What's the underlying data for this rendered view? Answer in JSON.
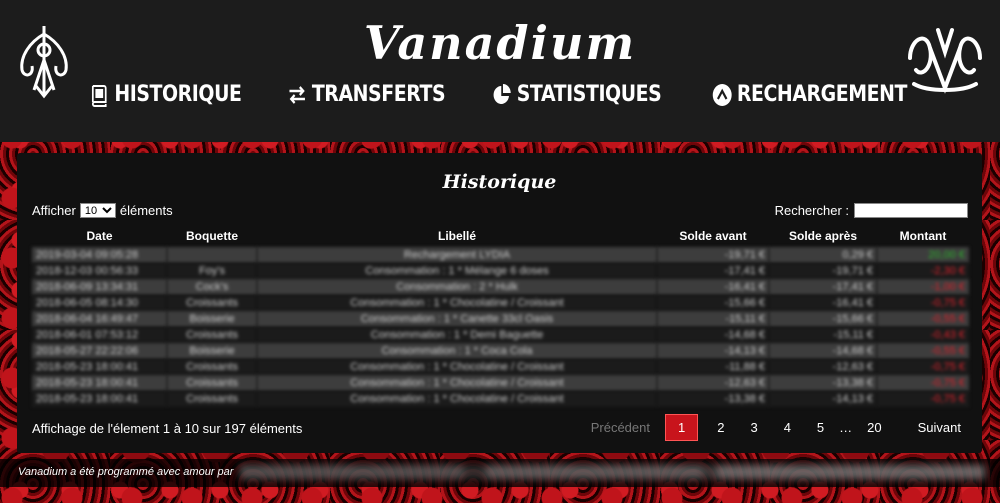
{
  "app": {
    "title": "Vanadium"
  },
  "nav": {
    "items": [
      {
        "label": "HISTORIQUE",
        "icon": "book-icon"
      },
      {
        "label": "TRANSFERTS",
        "icon": "exchange-icon"
      },
      {
        "label": "STATISTIQUES",
        "icon": "pie-chart-icon"
      },
      {
        "label": "RECHARGEMENT",
        "icon": "arrow-up-circle-icon"
      }
    ]
  },
  "panel": {
    "title": "Historique",
    "length_prefix": "Afficher",
    "length_value": "10",
    "length_suffix": "éléments",
    "search_label": "Rechercher :",
    "search_value": ""
  },
  "table": {
    "headers": [
      "Date",
      "Boquette",
      "Libellé",
      "Solde avant",
      "Solde après",
      "Montant"
    ],
    "rows": [
      {
        "date": "2019-03-04 09:05:28",
        "boquette": "",
        "libelle": "Rechargement LYDIA",
        "avant": "-19,71 €",
        "apres": "0,29 €",
        "montant": "20,00 €"
      },
      {
        "date": "2018-12-03 00:56:33",
        "boquette": "Foy's",
        "libelle": "Consommation : 1 * Mélange 6 doses",
        "avant": "-17,41 €",
        "apres": "-19,71 €",
        "montant": "-2,30 €"
      },
      {
        "date": "2018-06-09 13:34:31",
        "boquette": "Cock's",
        "libelle": "Consommation : 2 * Hulk",
        "avant": "-16,41 €",
        "apres": "-17,41 €",
        "montant": "-1,00 €"
      },
      {
        "date": "2018-06-05 08:14:30",
        "boquette": "Croissants",
        "libelle": "Consommation : 1 * Chocolatine / Croissant",
        "avant": "-15,66 €",
        "apres": "-16,41 €",
        "montant": "-0,75 €"
      },
      {
        "date": "2018-06-04 16:49:47",
        "boquette": "Boisserie",
        "libelle": "Consommation : 1 * Canette 33cl Oasis",
        "avant": "-15,11 €",
        "apres": "-15,66 €",
        "montant": "-0,55 €"
      },
      {
        "date": "2018-06-01 07:53:12",
        "boquette": "Croissants",
        "libelle": "Consommation : 1 * Demi Baguette",
        "avant": "-14,68 €",
        "apres": "-15,11 €",
        "montant": "-0,43 €"
      },
      {
        "date": "2018-05-27 22:22:06",
        "boquette": "Boisserie",
        "libelle": "Consommation : 1 * Coca Cola",
        "avant": "-14,13 €",
        "apres": "-14,68 €",
        "montant": "-0,55 €"
      },
      {
        "date": "2018-05-23 18:00:41",
        "boquette": "Croissants",
        "libelle": "Consommation : 1 * Chocolatine / Croissant",
        "avant": "-11,88 €",
        "apres": "-12,63 €",
        "montant": "-0,75 €"
      },
      {
        "date": "2018-05-23 18:00:41",
        "boquette": "Croissants",
        "libelle": "Consommation : 1 * Chocolatine / Croissant",
        "avant": "-12,63 €",
        "apres": "-13,38 €",
        "montant": "-0,75 €"
      },
      {
        "date": "2018-05-23 18:00:41",
        "boquette": "Croissants",
        "libelle": "Consommation : 1 * Chocolatine / Croissant",
        "avant": "-13,38 €",
        "apres": "-14,13 €",
        "montant": "-0,75 €"
      }
    ]
  },
  "info": "Affichage de l'élement 1 à 10 sur 197 éléments",
  "pagination": {
    "prev": "Précédent",
    "pages": [
      "1",
      "2",
      "3",
      "4",
      "5"
    ],
    "ellipsis": "…",
    "last": "20",
    "next": "Suivant",
    "current": "1"
  },
  "footer": {
    "text": "Vanadium a été programmé avec amour par"
  },
  "colors": {
    "accent": "#c8141c",
    "positive": "#2bb32b",
    "negative": "#e0202a",
    "header_bg": "#1c1c1c",
    "panel_bg": "#111111"
  }
}
